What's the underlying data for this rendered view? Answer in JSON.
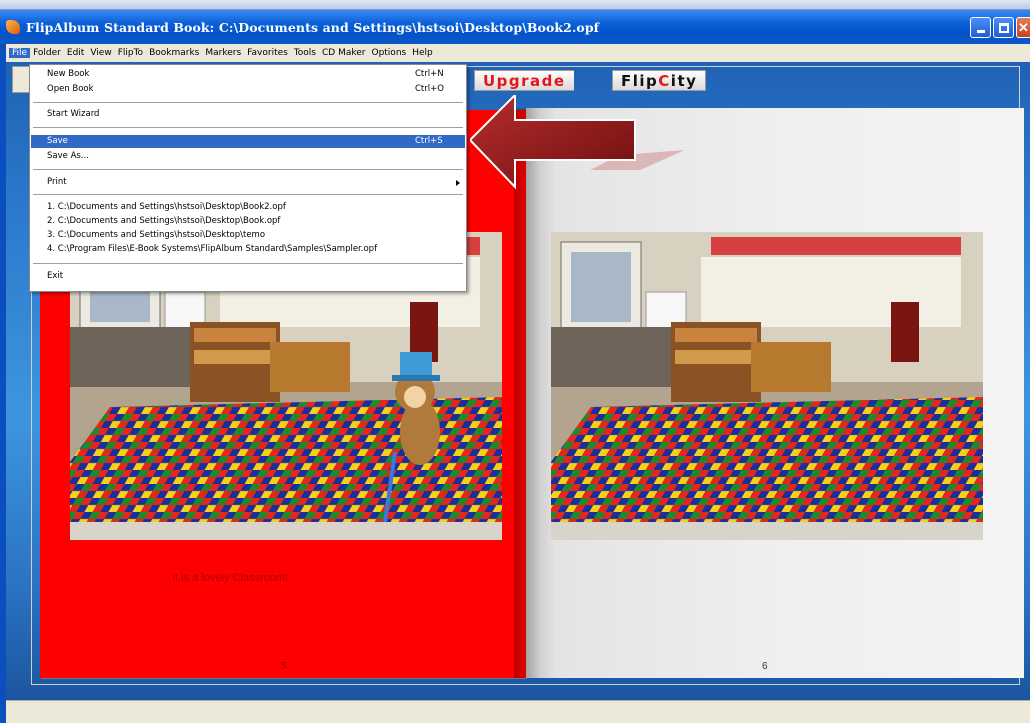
{
  "window": {
    "title": "FlipAlbum Standard   Book: C:\\Documents and Settings\\hstsoi\\Desktop\\Book2.opf",
    "icon": "flipalbum-app-icon"
  },
  "menubar": {
    "items": [
      "File",
      "Folder",
      "Edit",
      "View",
      "FlipTo",
      "Bookmarks",
      "Markers",
      "Favorites",
      "Tools",
      "CD Maker",
      "Options",
      "Help"
    ]
  },
  "toolbar": {
    "upgrade_label": "Upgrade",
    "flipcity_prefix": "Flip",
    "flipcity_c": "C",
    "flipcity_suffix": "ity"
  },
  "file_menu": {
    "new_book": "New Book",
    "new_book_sc": "Ctrl+N",
    "open_book": "Open Book",
    "open_book_sc": "Ctrl+O",
    "start_wizard": "Start Wizard",
    "save": "Save",
    "save_sc": "Ctrl+S",
    "save_as": "Save As...",
    "print": "Print",
    "recent": [
      "1. C:\\Documents and Settings\\hstsoi\\Desktop\\Book2.opf",
      "2. C:\\Documents and Settings\\hstsoi\\Desktop\\Book.opf",
      "3. C:\\Documents and Settings\\hstsoi\\Desktop\\temo",
      "4. C:\\Program Files\\E-Book Systems\\FlipAlbum Standard\\Samples\\Sampler.opf"
    ],
    "exit": "Exit"
  },
  "book": {
    "left_caption": "It is a lovely Classroom!",
    "left_page_number": "5",
    "right_page_number": "6"
  },
  "colors": {
    "left_page": "#ff0000",
    "highlight": "#316ac5",
    "arrow": "#8f1a1a"
  }
}
